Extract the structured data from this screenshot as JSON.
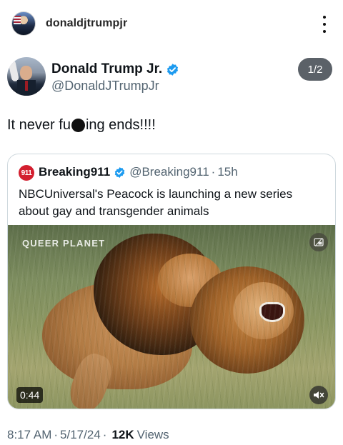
{
  "instagram_header": {
    "username": "donaldjtrumpjr",
    "more_icon": "more-vertical-icon"
  },
  "tweet": {
    "display_name": "Donald Trump Jr.",
    "handle": "@DonaldJTrumpJr",
    "page_indicator": "1/2",
    "text_before": "It never fu",
    "text_after": "ing ends!!!!",
    "verified_color": "#1d9bf0",
    "footer": {
      "time": "8:17 AM",
      "date": "5/17/24",
      "views_count": "12K",
      "views_label": "Views",
      "separator": "·"
    }
  },
  "quoted_tweet": {
    "avatar_text": "911",
    "display_name": "Breaking911",
    "handle": "@Breaking911",
    "separator": "·",
    "age": "15h",
    "text": "NBCUniversal's Peacock is launching a new series about gay and transgender animals",
    "video": {
      "watermark": "QUEER PLANET",
      "duration": "0:44",
      "top_icon": "picture-in-picture-icon",
      "mute_icon": "volume-muted-icon"
    }
  },
  "colors": {
    "text_primary": "#0f1419",
    "text_secondary": "#536471",
    "border": "#cfd9de",
    "brand_red": "#d31f2f",
    "badge_bg": "#5b6168"
  }
}
